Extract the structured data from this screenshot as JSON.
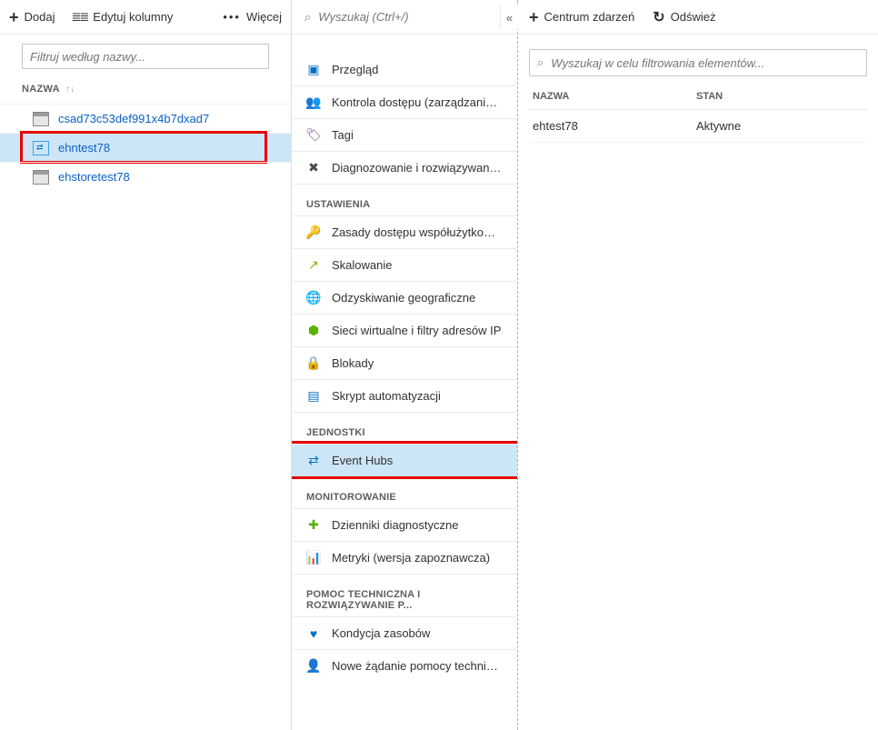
{
  "panel1": {
    "toolbar": {
      "add": "Dodaj",
      "edit_columns": "Edytuj kolumny",
      "more": "Więcej"
    },
    "filter_placeholder": "Filtruj według nazwy...",
    "column_header": "NAZWA",
    "items": [
      {
        "label": "csad73c53def991x4b7dxad7",
        "icon": "storage"
      },
      {
        "label": "ehntest78",
        "icon": "eh",
        "selected": true
      },
      {
        "label": "ehstoretest78",
        "icon": "storage"
      }
    ]
  },
  "panel2": {
    "search_placeholder": "Wyszukaj (Ctrl+/)",
    "sections": [
      {
        "title": "",
        "items": [
          {
            "label": "Przegląd",
            "icon": "overview",
            "color": "#0072c6"
          },
          {
            "label": "Kontrola dostępu (zarządzanie d..",
            "icon": "people",
            "color": "#0072c6"
          },
          {
            "label": "Tagi",
            "icon": "tag",
            "color": "#7b4ba0"
          },
          {
            "label": "Diagnozowanie i rozwiązywanie..",
            "icon": "tools",
            "color": "#4a4a4a"
          }
        ]
      },
      {
        "title": "USTAWIENIA",
        "items": [
          {
            "label": "Zasady dostępu współużytkowa..",
            "icon": "key",
            "color": "#f2b90f"
          },
          {
            "label": "Skalowanie",
            "icon": "scale",
            "color": "#7fba00"
          },
          {
            "label": "Odzyskiwanie geograficzne",
            "icon": "globe",
            "color": "#0072c6"
          },
          {
            "label": "Sieci wirtualne i filtry adresów IP",
            "icon": "vnet",
            "color": "#59b300"
          },
          {
            "label": "Blokady",
            "icon": "lock",
            "color": "#333"
          },
          {
            "label": "Skrypt automatyzacji",
            "icon": "script",
            "color": "#0072c6"
          }
        ]
      },
      {
        "title": "JEDNOSTKI",
        "items": [
          {
            "label": "Event Hubs",
            "icon": "eventhubs",
            "color": "#0072c6",
            "selected": true
          }
        ]
      },
      {
        "title": "MONITOROWANIE",
        "items": [
          {
            "label": "Dzienniki diagnostyczne",
            "icon": "diag",
            "color": "#59b300"
          },
          {
            "label": "Metryki (wersja zapoznawcza)",
            "icon": "metrics",
            "color": "#0072c6"
          }
        ]
      },
      {
        "title": "POMOC TECHNICZNA I ROZWIĄZYWANIE P...",
        "items": [
          {
            "label": "Kondycja zasobów",
            "icon": "health",
            "color": "#0072c6"
          },
          {
            "label": "Nowe żądanie pomocy technicznej",
            "icon": "support",
            "color": "#0072c6"
          }
        ]
      }
    ]
  },
  "panel3": {
    "toolbar": {
      "event_hub": "Centrum zdarzeń",
      "refresh": "Odśwież"
    },
    "search_placeholder": "Wyszukaj w celu filtrowania elementów...",
    "columns": {
      "name": "NAZWA",
      "status": "STAN"
    },
    "rows": [
      {
        "name": "ehtest78",
        "status": "Aktywne"
      }
    ]
  },
  "icons": {
    "plus": "+",
    "columns_glyph": "≣≣",
    "more": "•••",
    "sort": "↑↓",
    "collapse": "«",
    "refresh_glyph": "↻",
    "search_glyph": "⌕"
  }
}
